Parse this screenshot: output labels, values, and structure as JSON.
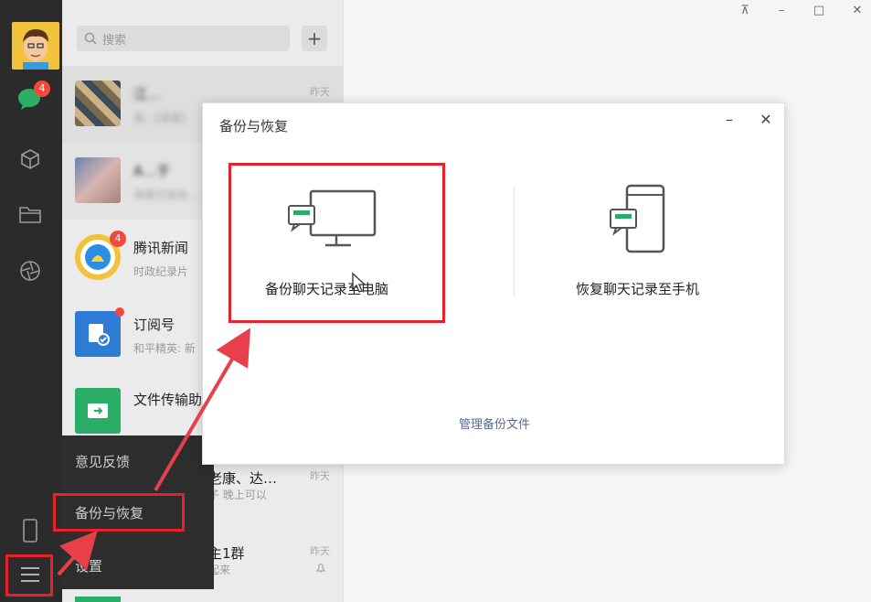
{
  "window_controls": {
    "pin": "⊼",
    "minimize": "–",
    "maximize": "□",
    "close": "✕"
  },
  "nav": {
    "chat_badge": "4"
  },
  "search": {
    "placeholder": "搜索",
    "add_label": "+"
  },
  "chat_list": [
    {
      "title": "江…",
      "subtitle": "自…[语音]",
      "time": "昨天",
      "blurred": true
    },
    {
      "title": "A…于",
      "subtitle": "消息已发出…",
      "time": "",
      "blurred": true
    },
    {
      "title": "腾讯新闻",
      "subtitle": "时政纪录片",
      "time": "",
      "badge": "4"
    },
    {
      "title": "订阅号",
      "subtitle": "和平精英: 新",
      "time": ""
    },
    {
      "title": "文件传输助",
      "subtitle": "",
      "time": ""
    },
    {
      "title": "老康、达…",
      "subtitle": "子 晚上可以",
      "time": "昨天"
    },
    {
      "title": "主1群",
      "subtitle": "起来",
      "time": "昨天"
    }
  ],
  "menu": {
    "feedback": "意见反馈",
    "backup_restore": "备份与恢复",
    "settings": "设置"
  },
  "dialog": {
    "title": "备份与恢复",
    "minimize": "–",
    "close": "✕",
    "backup_to_pc": "备份聊天记录至电脑",
    "restore_to_phone": "恢复聊天记录至手机",
    "manage_backups": "管理备份文件"
  },
  "colors": {
    "highlight": "#e8202a",
    "link": "#576b95",
    "wechat_green": "#2aae67"
  }
}
